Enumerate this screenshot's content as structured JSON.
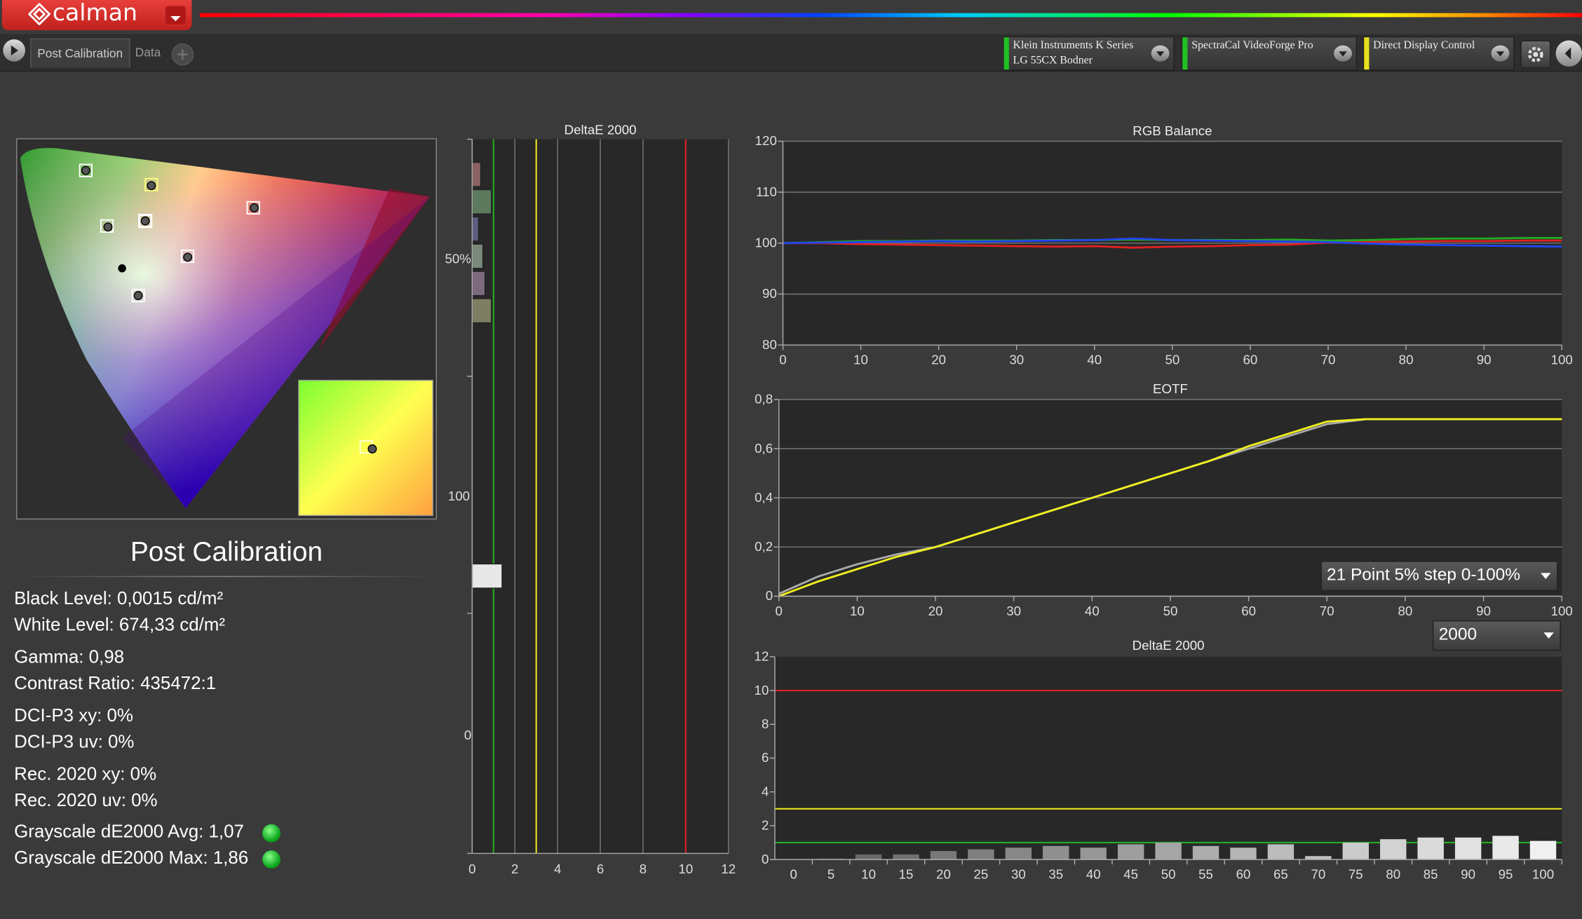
{
  "app": {
    "name": "calman"
  },
  "tabs": [
    {
      "label": "Post Calibration"
    },
    {
      "label": "Data"
    }
  ],
  "devices": [
    {
      "line1": "Klein Instruments K Series",
      "line2": "LG 55CX Bodner",
      "color": "#22c022"
    },
    {
      "line1": "SpectraCal VideoForge Pro",
      "line2": "",
      "color": "#22c022"
    },
    {
      "line1": "Direct Display Control",
      "line2": "",
      "color": "#e8e020"
    }
  ],
  "page": {
    "title": "Post Calibration"
  },
  "stats": {
    "black_level": "Black Level: 0,0015 cd/m²",
    "white_level": "White Level: 674,33 cd/m²",
    "gamma": "Gamma: 0,98",
    "contrast": "Contrast Ratio: 435472:1",
    "dcip3_xy": "DCI-P3 xy: 0%",
    "dcip3_uv": "DCI-P3 uv: 0%",
    "rec2020_xy": "Rec. 2020 xy: 0%",
    "rec2020_uv": "Rec. 2020 uv: 0%",
    "gs_avg": "Grayscale dE2000 Avg: 1,07",
    "gs_max": "Grayscale dE2000 Max: 1,86",
    "status_color": "#22c022"
  },
  "luminance_scale": {
    "labels": [
      "50%",
      "100",
      "0"
    ]
  },
  "selectors": {
    "pattern": "21 Point 5% step 0-100%",
    "de_formula": "2000"
  },
  "chart_data": [
    {
      "type": "bar",
      "title": "DeltaE 2000",
      "orientation": "horizontal",
      "xlim": [
        0,
        12
      ],
      "xticks": [
        0,
        2,
        4,
        6,
        8,
        10,
        12
      ],
      "thresholds": [
        {
          "value": 1,
          "color": "#22aa22"
        },
        {
          "value": 3,
          "color": "#e8e020"
        },
        {
          "value": 10,
          "color": "#dd2222"
        }
      ],
      "values": [
        0.4,
        0.9,
        0.3,
        0.5,
        0.6,
        0.9,
        1.4
      ],
      "colors": [
        "#8a6262",
        "#5e7a5e",
        "#5e5e84",
        "#7a8a7a",
        "#7e6a7e",
        "#7e7e62",
        "#e8e8e8"
      ]
    },
    {
      "type": "line",
      "title": "RGB Balance",
      "xlim": [
        0,
        100
      ],
      "ylim": [
        80,
        120
      ],
      "xticks": [
        0,
        10,
        20,
        30,
        40,
        50,
        60,
        70,
        80,
        90,
        100
      ],
      "yticks": [
        80,
        90,
        100,
        110,
        120
      ],
      "x": [
        0,
        5,
        10,
        15,
        20,
        25,
        30,
        35,
        40,
        45,
        50,
        55,
        60,
        65,
        70,
        75,
        80,
        85,
        90,
        95,
        100
      ],
      "series": [
        {
          "color": "#dd2222",
          "values": [
            100,
            100,
            99.8,
            99.7,
            99.6,
            99.5,
            99.4,
            99.3,
            99.4,
            99.1,
            99.3,
            99.4,
            99.6,
            99.7,
            100.1,
            100.3,
            100.3,
            100.4,
            100.4,
            100.5,
            100.5
          ]
        },
        {
          "color": "#22aa22",
          "values": [
            100,
            100.2,
            100.4,
            100.4,
            100.5,
            100.5,
            100.5,
            100.6,
            100.6,
            100.7,
            100.6,
            100.6,
            100.6,
            100.7,
            100.5,
            100.6,
            100.8,
            100.9,
            100.9,
            101,
            101
          ]
        },
        {
          "color": "#2244ee",
          "values": [
            100,
            100.1,
            100.2,
            100.3,
            100.4,
            100.3,
            100.4,
            100.5,
            100.6,
            100.9,
            100.6,
            100.5,
            100.4,
            100.3,
            100.2,
            99.9,
            99.7,
            99.6,
            99.5,
            99.4,
            99.3
          ]
        }
      ]
    },
    {
      "type": "line",
      "title": "EOTF",
      "xlim": [
        0,
        100
      ],
      "ylim": [
        0,
        0.8
      ],
      "xticks": [
        0,
        10,
        20,
        30,
        40,
        50,
        60,
        70,
        80,
        90,
        100
      ],
      "yticks": [
        "0",
        "0,2",
        "0,4",
        "0,6",
        "0,8"
      ],
      "x": [
        0,
        5,
        10,
        15,
        20,
        25,
        30,
        35,
        40,
        45,
        50,
        55,
        60,
        65,
        70,
        75,
        80,
        85,
        90,
        95,
        100
      ],
      "series": [
        {
          "color": "#aaaaaa",
          "values": [
            0.01,
            0.08,
            0.13,
            0.17,
            0.2,
            0.25,
            0.3,
            0.35,
            0.4,
            0.45,
            0.5,
            0.55,
            0.6,
            0.65,
            0.7,
            0.72,
            0.72,
            0.72,
            0.72,
            0.72,
            0.72
          ]
        },
        {
          "color": "#f0f020",
          "values": [
            0,
            0.06,
            0.11,
            0.16,
            0.2,
            0.25,
            0.3,
            0.35,
            0.4,
            0.45,
            0.5,
            0.55,
            0.61,
            0.66,
            0.71,
            0.72,
            0.72,
            0.72,
            0.72,
            0.72,
            0.72
          ]
        }
      ]
    },
    {
      "type": "bar",
      "title": "DeltaE 2000",
      "ylim": [
        0,
        12
      ],
      "yticks": [
        0,
        2,
        4,
        6,
        8,
        10,
        12
      ],
      "categories": [
        "0",
        "5",
        "10",
        "15",
        "20",
        "25",
        "30",
        "35",
        "40",
        "45",
        "50",
        "55",
        "60",
        "65",
        "70",
        "75",
        "80",
        "85",
        "90",
        "95",
        "100"
      ],
      "values": [
        0,
        0.05,
        0.3,
        0.3,
        0.5,
        0.6,
        0.7,
        0.8,
        0.7,
        0.9,
        1.0,
        0.8,
        0.7,
        0.9,
        0.2,
        1.0,
        1.2,
        1.3,
        1.3,
        1.4,
        1.1
      ],
      "thresholds": [
        {
          "value": 1,
          "color": "#22aa22"
        },
        {
          "value": 3,
          "color": "#e8e020"
        },
        {
          "value": 10,
          "color": "#dd2222"
        }
      ]
    }
  ]
}
